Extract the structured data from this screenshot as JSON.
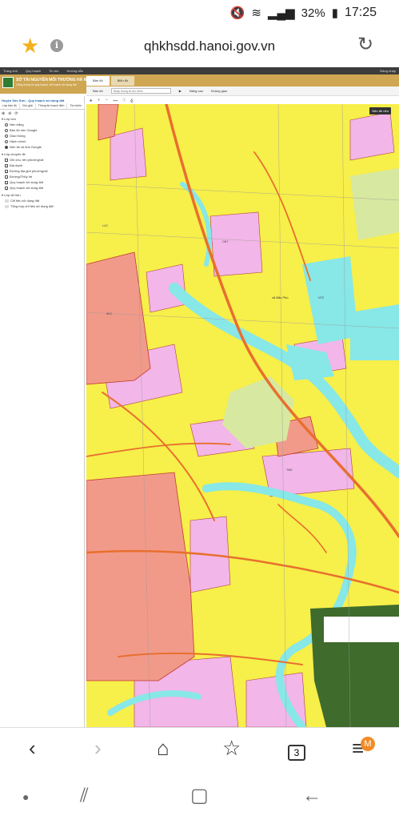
{
  "status": {
    "battery": "32%",
    "time": "17:25"
  },
  "browser": {
    "url": "qhkhsdd.hanoi.gov.vn",
    "tab_count": "3",
    "menu_badge": "M"
  },
  "site": {
    "topnav": [
      "Trang chủ",
      "Quy hoạch",
      "Tin tức",
      "Hướng dẫn"
    ],
    "login": "Đăng nhập",
    "org_name": "SỞ TÀI NGUYÊN MÔI TRƯỜNG HÀ NỘI",
    "org_sub": "Cổng thông tin quy hoạch, kế hoạch sử dụng đất",
    "main_tabs": [
      "Bản đồ",
      "Biểu đồ"
    ],
    "toolbar": {
      "zoom": "Bản đồ",
      "search_placeholder": "Nhập thông tin tìm kiếm",
      "tools": [
        "Nâng cao",
        "Không gian"
      ]
    }
  },
  "sidebar": {
    "title": "Huyện Sóc Sơn - Quy hoạch sử dụng đất",
    "tabs": [
      "Lớp bản đồ",
      "Chú giải",
      "Thông tin hoạch định",
      "Tìm kiếm"
    ],
    "groups": [
      {
        "label": "Lớp nền",
        "items": [
          "Nền trắng",
          "Bản đồ nền Google",
          "Giao thông",
          "Hành chính",
          "Nền đồ vệ tinh Google"
        ]
      },
      {
        "label": "Lớp chuyên đề",
        "items": [
          "Ghi chú, tên phường/xã",
          "Địa danh",
          "Đường địa giới phường/xã",
          "Đường/Thủy hệ",
          "Quy hoạch sử dụng đất",
          "Quy hoạch sử dụng đất"
        ]
      },
      {
        "label": "Lớp dữ liệu",
        "items": [
          "Chỉ tiêu sử dụng đất",
          "Tổng hợp chỉ tiêu sử dụng đất"
        ]
      }
    ]
  },
  "map": {
    "basemap_button": "Nền đồ nền",
    "place_label": "xã Bắc Phú",
    "land_codes": [
      "LUC",
      "ONT",
      "SKC",
      "NTS",
      "TMD",
      "CLN",
      "DGT",
      "ODT",
      "RSX",
      "DTL"
    ],
    "colors": {
      "agri": "#f7ef4a",
      "residential": "#f2b6e8",
      "water": "#88e7e7",
      "industry": "#f29a8a",
      "road": "#e86f2e",
      "green": "#d7e8a0",
      "forest": "#3f6b2c"
    }
  }
}
